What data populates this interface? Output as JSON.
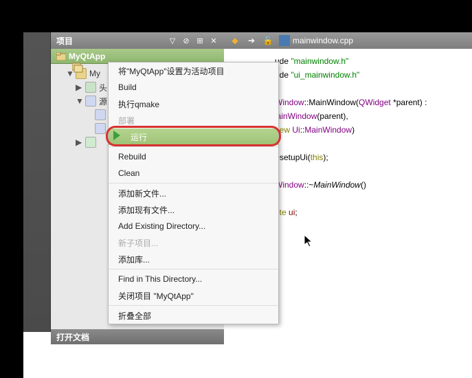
{
  "header": {
    "title": "项目"
  },
  "header_icons": {
    "filter": "filter-icon",
    "link": "link-icon",
    "split": "split-icon",
    "close": "close-icon"
  },
  "sidebar": {
    "project": "MyQtApp",
    "rows": [
      {
        "label": "My",
        "indent": 1,
        "expandable": true,
        "expanded": true
      },
      {
        "label": "头",
        "indent": 2,
        "expandable": true,
        "expanded": false,
        "icon": "h"
      },
      {
        "label": "源",
        "indent": 2,
        "expandable": true,
        "expanded": true,
        "icon": "cpp"
      },
      {
        "label": "",
        "indent": 3,
        "icon": "cpp"
      },
      {
        "label": "",
        "indent": 3,
        "icon": "cpp"
      },
      {
        "label": "",
        "indent": 2,
        "expandable": true,
        "expanded": false,
        "icon": "form"
      }
    ]
  },
  "open_docs": "打开文档",
  "toolbar": {
    "back": "back-icon",
    "fwd": "fwd-icon",
    "lock": "lock-icon",
    "file_icon": "cpp-file-icon",
    "filename": "mainwindow.cpp"
  },
  "context_menu": [
    {
      "label": "将\"MyQtApp\"设置为活动项目",
      "type": "item"
    },
    {
      "label": "Build",
      "type": "item"
    },
    {
      "label": "执行qmake",
      "type": "item"
    },
    {
      "label": "部署",
      "type": "item",
      "disabled": true
    },
    {
      "label": "运行",
      "type": "item",
      "highlight": true
    },
    {
      "type": "sep"
    },
    {
      "label": "Rebuild",
      "type": "item"
    },
    {
      "label": "Clean",
      "type": "item"
    },
    {
      "type": "sep"
    },
    {
      "label": "添加新文件...",
      "type": "item"
    },
    {
      "label": "添加现有文件...",
      "type": "item"
    },
    {
      "label": "Add Existing Directory...",
      "type": "item"
    },
    {
      "label": "新子项目...",
      "type": "item",
      "disabled": true
    },
    {
      "label": "添加库...",
      "type": "item"
    },
    {
      "type": "sep"
    },
    {
      "label": "Find in This Directory...",
      "type": "item"
    },
    {
      "label": "关闭项目 \"MyQtApp\"",
      "type": "item"
    },
    {
      "type": "sep"
    },
    {
      "label": "折叠全部",
      "type": "item"
    }
  ],
  "code": {
    "l1a": "ude ",
    "l1b": "\"mainwindow.h\"",
    "l2a": "ude ",
    "l2b": "\"ui_mainwindow.h\"",
    "l3a": "Window",
    "l3b": "::MainWindow(",
    "l3c": "QWidget",
    "l3d": " *parent) :",
    "l4a": "lainWindow",
    "l4b": "(parent),",
    "l5a": "new ",
    "l5b": "Ui",
    "l5c": "::",
    "l5d": "MainWindow",
    "l5e": ")",
    "l6a": ">setupUi(",
    "l6b": "this",
    "l6c": ");",
    "l7a": "Window",
    "l7b": "::~",
    "l7c": "MainWindow",
    "l7d": "()",
    "l8a": "ete ",
    "l8b": "ui",
    "l8c": ";"
  }
}
